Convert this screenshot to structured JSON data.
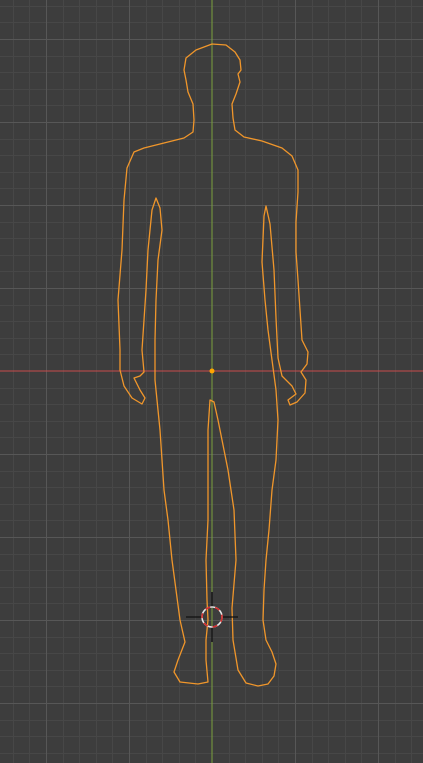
{
  "viewport": {
    "background_color": "#3d3d3d",
    "grid_minor_color": "#474747",
    "grid_major_color": "#575757",
    "x_axis_color": "#c84b4b",
    "y_axis_color": "#7aa13d",
    "selection_outline_color": "#f0962b",
    "origin_color": "#ffa500",
    "cursor_ring_color": "#e8e8e8",
    "cursor_ring_accent_color": "#d42e2e",
    "cursor_crosshair_color": "#111111"
  },
  "objects": [
    {
      "name": "human-silhouette-mesh",
      "selected": true
    }
  ],
  "icons": {
    "cursor": "3d-cursor-icon",
    "origin": "object-origin-icon"
  }
}
